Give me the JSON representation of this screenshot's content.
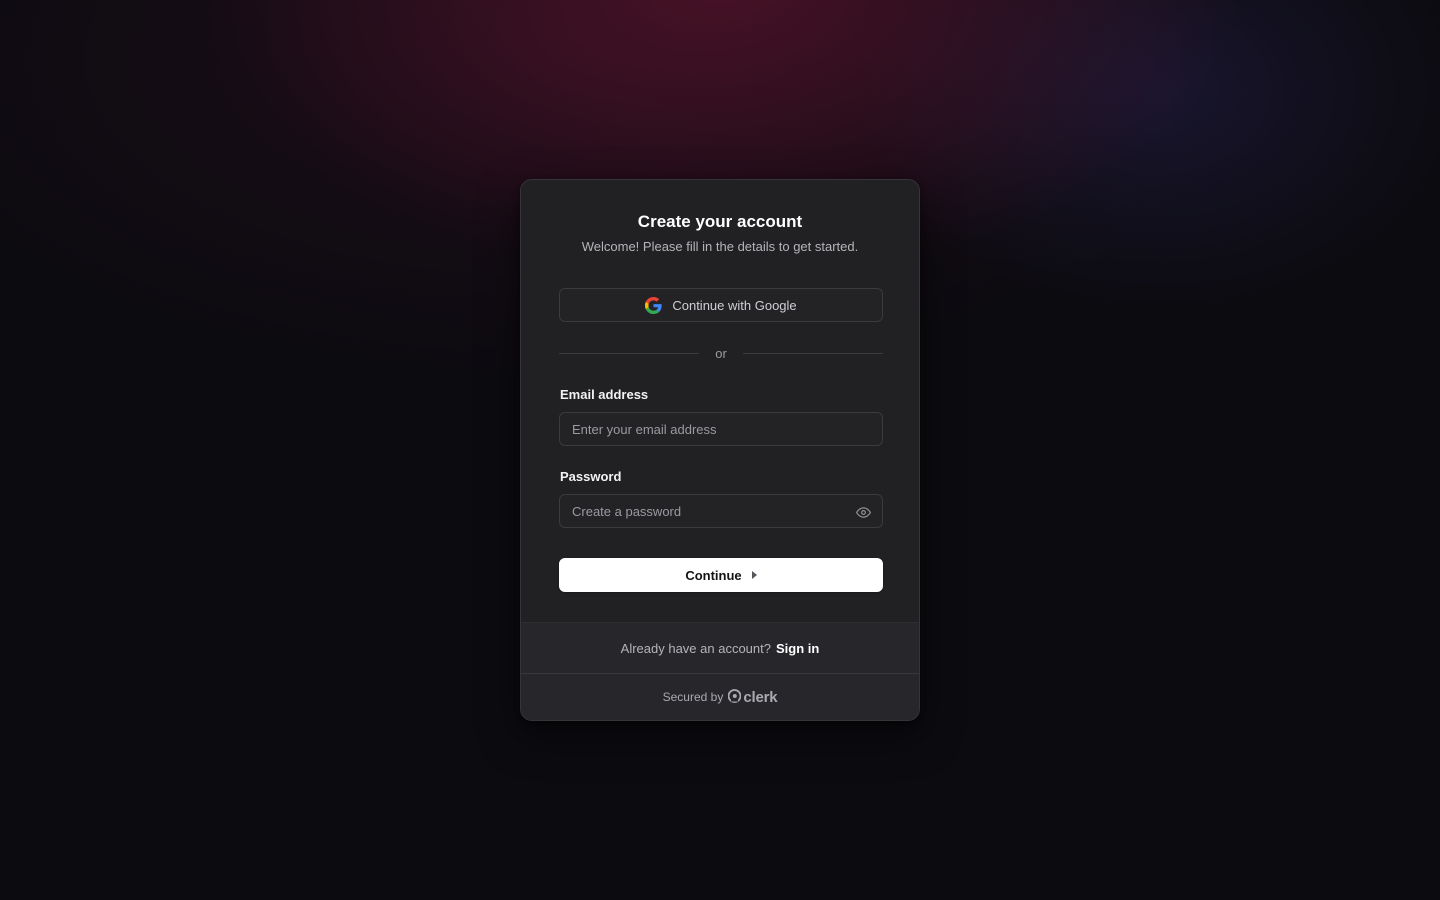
{
  "header": {
    "title": "Create your account",
    "subtitle": "Welcome! Please fill in the details to get started."
  },
  "social": {
    "google_label": "Continue with Google",
    "icon": "google-icon"
  },
  "divider": {
    "label": "or"
  },
  "form": {
    "email": {
      "label": "Email address",
      "placeholder": "Enter your email address",
      "value": ""
    },
    "password": {
      "label": "Password",
      "placeholder": "Create a password",
      "value": "",
      "toggle_icon": "eye-icon"
    },
    "continue_label": "Continue",
    "continue_icon": "caret-right-icon"
  },
  "footer": {
    "prompt": "Already have an account?",
    "signin_link": "Sign in",
    "secured_by": "Secured by",
    "brand": "clerk",
    "brand_icon": "clerk-logo-icon"
  },
  "colors": {
    "background": "#0c0b10",
    "card": "#212124",
    "footer": "#27272b",
    "primary_button": "#ffffff",
    "text_muted": "#b4b4ba"
  }
}
